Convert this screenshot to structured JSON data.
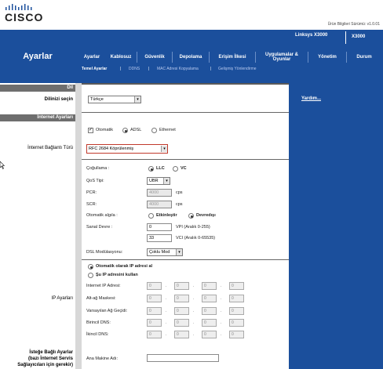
{
  "header": {
    "brand": "CISCO",
    "firmware": "Ürün Bilgileri Sürümü: v1.0.01",
    "section_title": "Ayarlar",
    "model_name": "Linksys X3000",
    "model_code": "X3000"
  },
  "nav": {
    "tabs": [
      {
        "label": "Ayarlar"
      },
      {
        "label": "Kablosuz"
      },
      {
        "label": "Güvenlik"
      },
      {
        "label": "Depolama"
      },
      {
        "label": "Erişim İlkesi"
      },
      {
        "label": "Uygulamalar & Oyunlar"
      },
      {
        "label": "Yönetim"
      },
      {
        "label": "Durum"
      }
    ],
    "subtabs": [
      {
        "label": "Temel Ayarlar"
      },
      {
        "label": "DDNS"
      },
      {
        "label": "MAC Adresi Kopyalama"
      },
      {
        "label": "Gelişmiş Yönlendirme"
      }
    ],
    "sep": "|"
  },
  "sidebar": {
    "lang_section": "Dil",
    "lang_label": "Dilinizi seçin",
    "internet_section": "İnternet Ayarları",
    "connection_type_label": "İnternet Bağlantı Türü",
    "ip_settings_label": "IP Ayarları",
    "optional_label_1": "İsteğe Bağlı Ayarlar",
    "optional_label_2": "(bazı İnternet Servis",
    "optional_label_3": "Sağlayıcıları için gerekir)"
  },
  "help": {
    "link": "Yardım..."
  },
  "form": {
    "language_value": "Türkçe",
    "detect": {
      "auto": "Otomatik",
      "adsl": "ADSL",
      "ethernet": "Ethernet"
    },
    "connection_type_value": "RFC 2684 Köprülenmiş",
    "multiplexing": {
      "label": "Çoğullama :",
      "llc": "LLC",
      "vc": "VC"
    },
    "qos": {
      "label": "QoS Tipi:",
      "value": "UBR"
    },
    "pcr": {
      "label": "PCR:",
      "value": "4000",
      "unit": "cps"
    },
    "scr": {
      "label": "SCR:",
      "value": "4000",
      "unit": "cps"
    },
    "auto_detect": {
      "label": "Otomatik algıla :",
      "enable": "Etkinleştir",
      "disable": "Devredışı"
    },
    "virtual_circuit": {
      "label": "Sanal Devre :",
      "vpi_value": "0",
      "vpi_text": "VPI (Aralık 0-255)",
      "vci_value": "33",
      "vci_text": "VCI (Aralık 0-65535)"
    },
    "dsl_modulation": {
      "label": "DSL Modülasyonu:",
      "value": "Çoklu Mod"
    },
    "ip_mode": {
      "auto": "Otomatik olarak IP adresi al",
      "manual": "Şu IP adresini kullan"
    },
    "ip_fields": [
      {
        "label": "Internet IP Adresi:"
      },
      {
        "label": "Alt-ağ Maskesi:"
      },
      {
        "label": "Varsayılan Ağ Geçidi:"
      },
      {
        "label": "Birincil DNS:"
      },
      {
        "label": "İkincil DNS:"
      }
    ],
    "ip_octet_value": "0",
    "hostname": {
      "label": "Ana Makine Adı:",
      "value": ""
    }
  },
  "colors": {
    "brand_blue": "#1b4f9c",
    "section_gray": "#6e6e6e",
    "highlight_red": "#c0392b"
  }
}
